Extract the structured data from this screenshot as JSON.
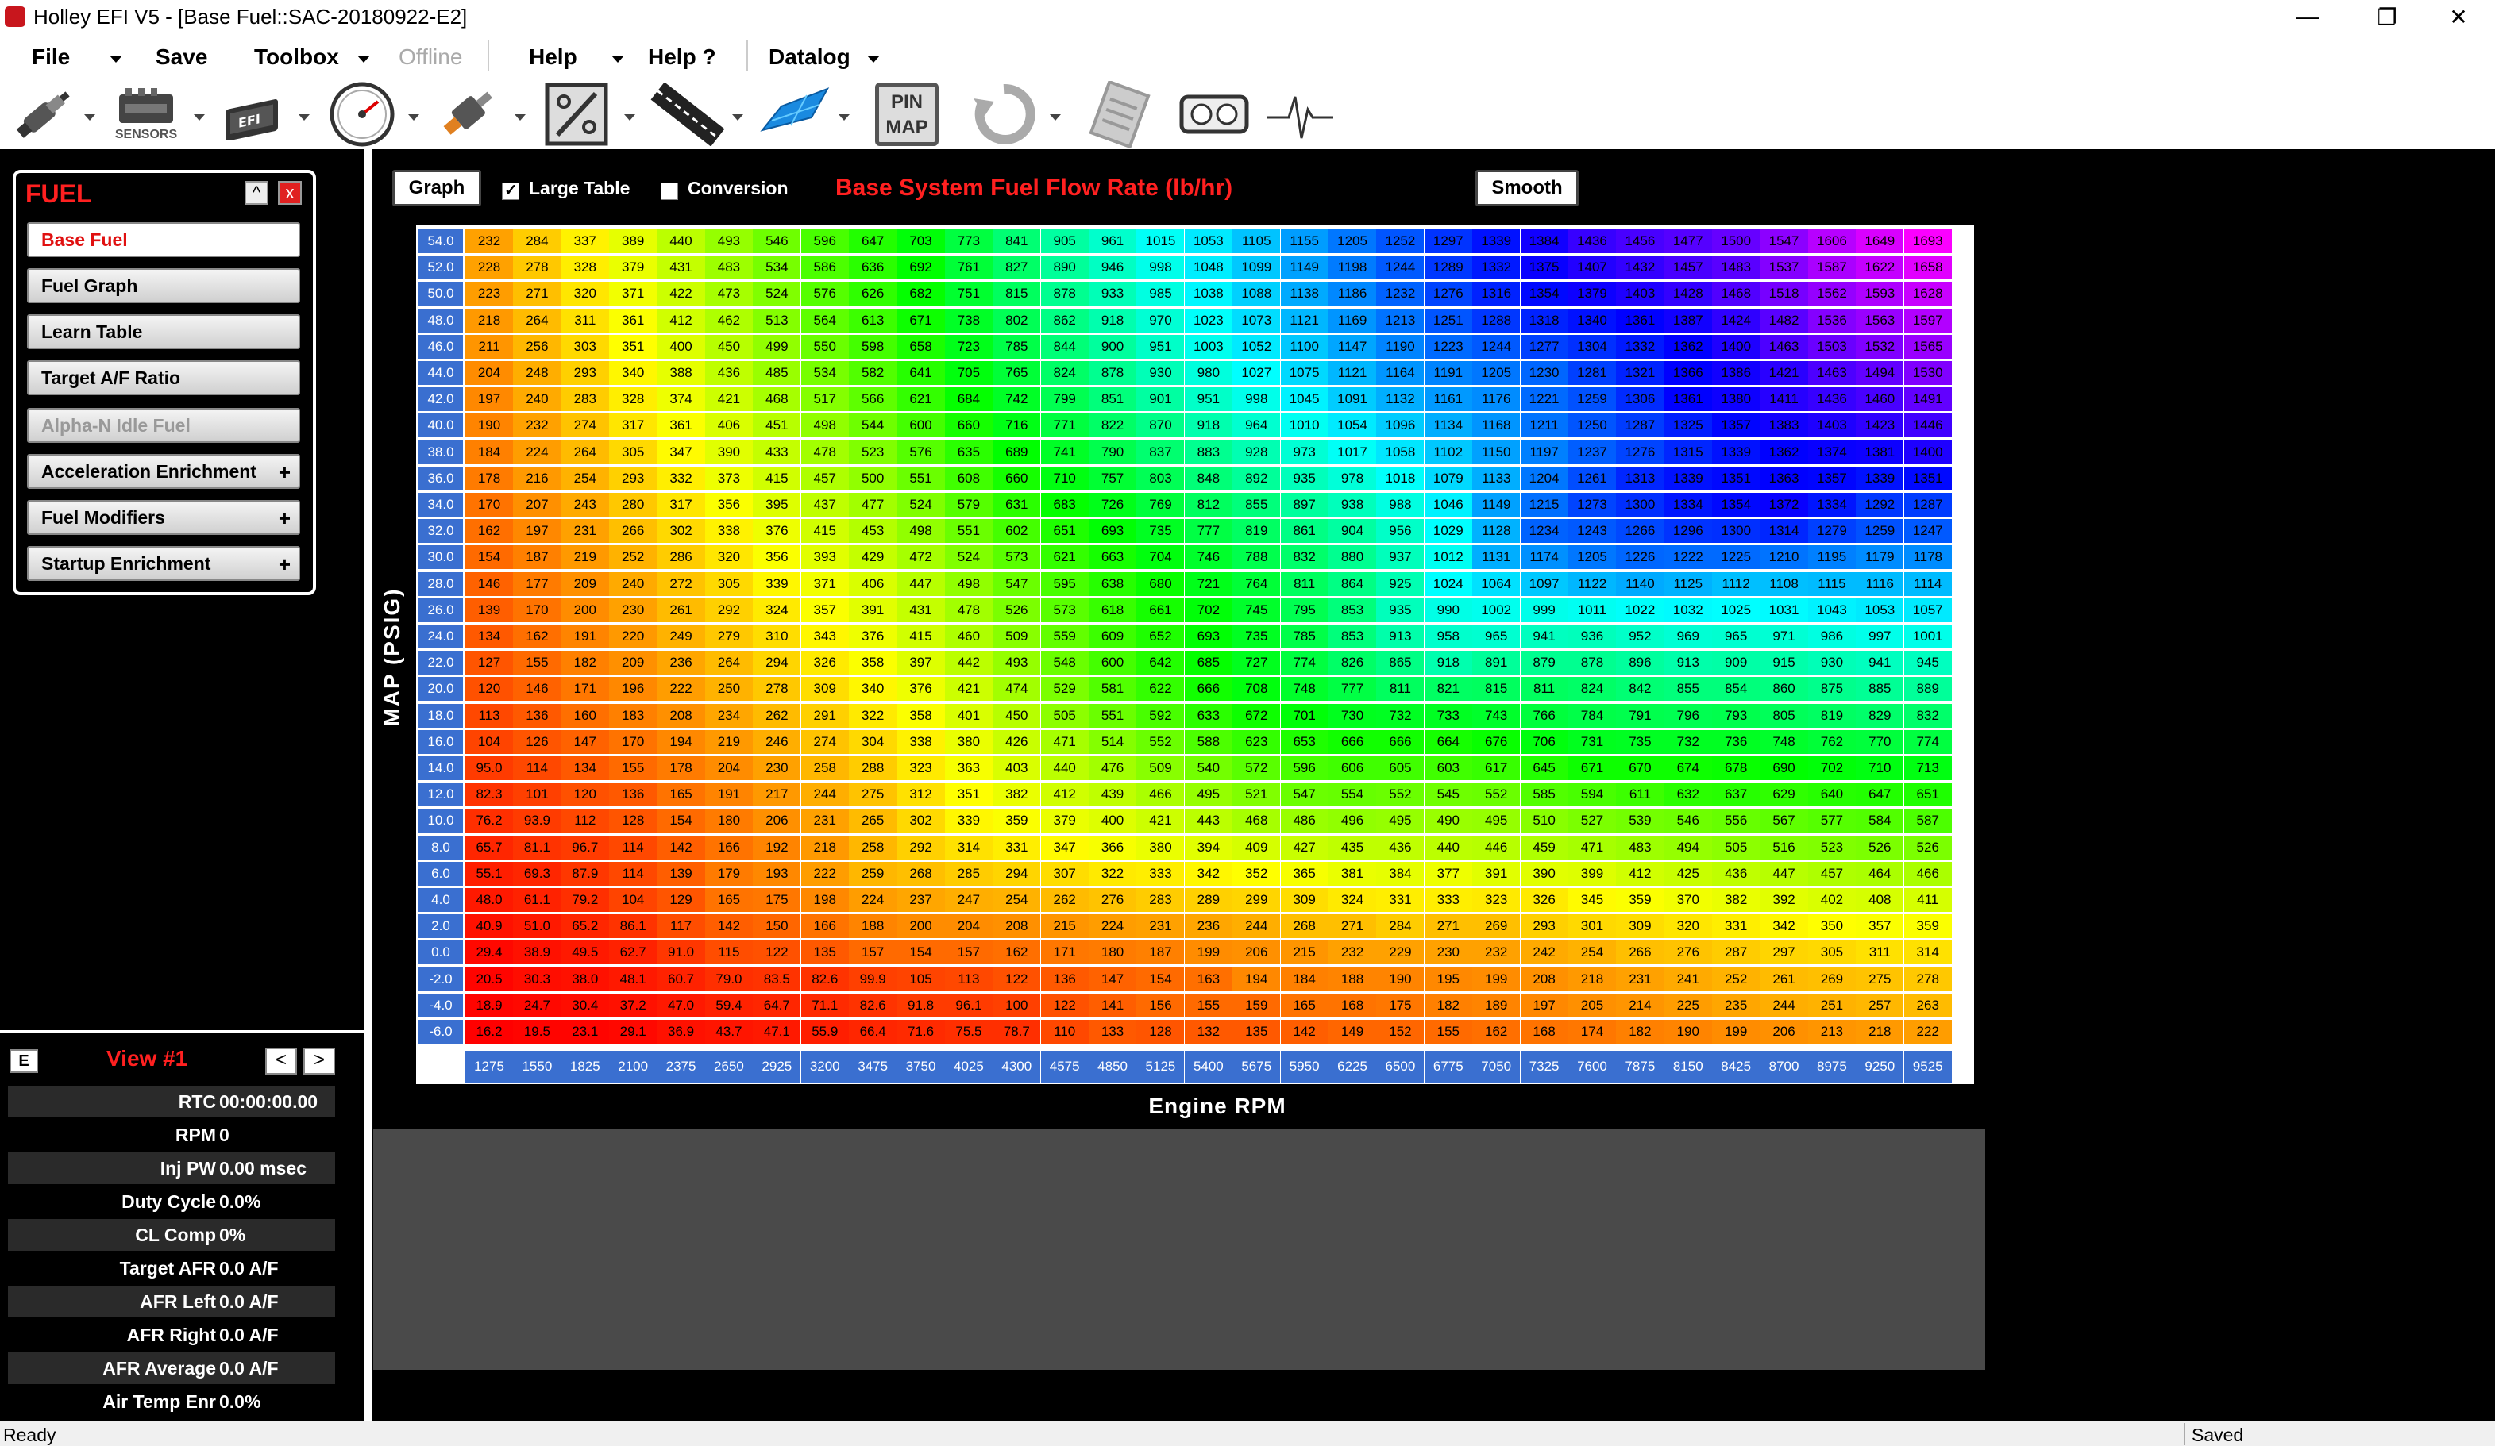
{
  "window": {
    "title": "Holley EFI V5 - [Base Fuel::SAC-20180922-E2]",
    "minimize": "—",
    "restore": "❐",
    "close": "✕"
  },
  "menu": [
    {
      "label": "File",
      "caret": true,
      "disabled": false
    },
    {
      "label": "Save",
      "caret": false,
      "disabled": false
    },
    {
      "label": "Toolbox",
      "caret": true,
      "disabled": false
    },
    {
      "label": "Offline",
      "caret": false,
      "disabled": true
    },
    {
      "label": "Help",
      "caret": true,
      "disabled": false
    },
    {
      "label": "Help ?",
      "caret": false,
      "disabled": false
    },
    {
      "label": "Datalog",
      "caret": true,
      "disabled": false
    }
  ],
  "toolbar": {
    "icons": [
      "injector-icon",
      "sensors-icon",
      "ecu-icon",
      "gauge-icon",
      "ignition-coil-icon",
      "percent-icon",
      "strap-icon",
      "grid-3d-icon",
      "pin-map-icon",
      "refresh-icon",
      "notepad-icon",
      "dashboard-icon",
      "waveform-icon"
    ],
    "sensors_label": "SENSORS",
    "pin_map_label": "PIN MAP"
  },
  "fuel_panel": {
    "title": "FUEL",
    "collapse": "^",
    "close": "x",
    "items": [
      {
        "label": "Base Fuel",
        "active": true,
        "disabled": false,
        "expandable": false
      },
      {
        "label": "Fuel Graph",
        "active": false,
        "disabled": false,
        "expandable": false
      },
      {
        "label": "Learn Table",
        "active": false,
        "disabled": false,
        "expandable": false
      },
      {
        "label": "Target A/F Ratio",
        "active": false,
        "disabled": false,
        "expandable": false
      },
      {
        "label": "Alpha-N Idle Fuel",
        "active": false,
        "disabled": true,
        "expandable": false
      },
      {
        "label": "Acceleration Enrichment",
        "active": false,
        "disabled": false,
        "expandable": true
      },
      {
        "label": "Fuel Modifiers",
        "active": false,
        "disabled": false,
        "expandable": true
      },
      {
        "label": "Startup Enrichment",
        "active": false,
        "disabled": false,
        "expandable": true
      }
    ]
  },
  "view_panel": {
    "e_button": "E",
    "title": "View #1",
    "prev": "<",
    "next": ">",
    "readouts": [
      {
        "label": "RTC",
        "value": "00:00:00.00"
      },
      {
        "label": "RPM",
        "value": "0"
      },
      {
        "label": "Inj PW",
        "value": "0.00 msec"
      },
      {
        "label": "Duty Cycle",
        "value": "0.0%"
      },
      {
        "label": "CL Comp",
        "value": "0%"
      },
      {
        "label": "Target AFR",
        "value": "0.0 A/F"
      },
      {
        "label": "AFR Left",
        "value": "0.0 A/F"
      },
      {
        "label": "AFR Right",
        "value": "0.0 A/F"
      },
      {
        "label": "AFR Average",
        "value": "0.0 A/F"
      },
      {
        "label": "Air Temp Enr",
        "value": "0.0%"
      }
    ]
  },
  "main": {
    "graph_button": "Graph",
    "large_table_label": "Large Table",
    "large_table_checked": true,
    "conversion_label": "Conversion",
    "conversion_checked": false,
    "table_title": "Base System Fuel Flow Rate (lb/hr)",
    "smooth_button": "Smooth",
    "y_axis_label": "MAP (PSIG)",
    "x_axis_label": "Engine RPM"
  },
  "table": {
    "rpm": [
      "1275",
      "1550",
      "1825",
      "2100",
      "2375",
      "2650",
      "2925",
      "3200",
      "3475",
      "3750",
      "4025",
      "4300",
      "4575",
      "4850",
      "5125",
      "5400",
      "5675",
      "5950",
      "6225",
      "6500",
      "6775",
      "7050",
      "7325",
      "7600",
      "7875",
      "8150",
      "8425",
      "8700",
      "8975",
      "9250",
      "9525"
    ],
    "map": [
      "54.0",
      "52.0",
      "50.0",
      "48.0",
      "46.0",
      "44.0",
      "42.0",
      "40.0",
      "38.0",
      "36.0",
      "34.0",
      "32.0",
      "30.0",
      "28.0",
      "26.0",
      "24.0",
      "22.0",
      "20.0",
      "18.0",
      "16.0",
      "14.0",
      "12.0",
      "10.0",
      "8.0",
      "6.0",
      "4.0",
      "2.0",
      "0.0",
      "-2.0",
      "-4.0",
      "-6.0"
    ],
    "values": [
      [
        "232",
        "284",
        "337",
        "389",
        "440",
        "493",
        "546",
        "596",
        "647",
        "703",
        "773",
        "841",
        "905",
        "961",
        "1015",
        "1053",
        "1105",
        "1155",
        "1205",
        "1252",
        "1297",
        "1339",
        "1384",
        "1436",
        "1456",
        "1477",
        "1500",
        "1547",
        "1606",
        "1649",
        "1693"
      ],
      [
        "228",
        "278",
        "328",
        "379",
        "431",
        "483",
        "534",
        "586",
        "636",
        "692",
        "761",
        "827",
        "890",
        "946",
        "998",
        "1048",
        "1099",
        "1149",
        "1198",
        "1244",
        "1289",
        "1332",
        "1375",
        "1407",
        "1432",
        "1457",
        "1483",
        "1537",
        "1587",
        "1622",
        "1658"
      ],
      [
        "223",
        "271",
        "320",
        "371",
        "422",
        "473",
        "524",
        "576",
        "626",
        "682",
        "751",
        "815",
        "878",
        "933",
        "985",
        "1038",
        "1088",
        "1138",
        "1186",
        "1232",
        "1276",
        "1316",
        "1354",
        "1379",
        "1403",
        "1428",
        "1468",
        "1518",
        "1562",
        "1593",
        "1628"
      ],
      [
        "218",
        "264",
        "311",
        "361",
        "412",
        "462",
        "513",
        "564",
        "613",
        "671",
        "738",
        "802",
        "862",
        "918",
        "970",
        "1023",
        "1073",
        "1121",
        "1169",
        "1213",
        "1251",
        "1288",
        "1318",
        "1340",
        "1361",
        "1387",
        "1424",
        "1482",
        "1536",
        "1563",
        "1597"
      ],
      [
        "211",
        "256",
        "303",
        "351",
        "400",
        "450",
        "499",
        "550",
        "598",
        "658",
        "723",
        "785",
        "844",
        "900",
        "951",
        "1003",
        "1052",
        "1100",
        "1147",
        "1190",
        "1223",
        "1244",
        "1277",
        "1304",
        "1332",
        "1362",
        "1400",
        "1463",
        "1503",
        "1532",
        "1565"
      ],
      [
        "204",
        "248",
        "293",
        "340",
        "388",
        "436",
        "485",
        "534",
        "582",
        "641",
        "705",
        "765",
        "824",
        "878",
        "930",
        "980",
        "1027",
        "1075",
        "1121",
        "1164",
        "1191",
        "1205",
        "1230",
        "1281",
        "1321",
        "1366",
        "1386",
        "1421",
        "1463",
        "1494",
        "1530"
      ],
      [
        "197",
        "240",
        "283",
        "328",
        "374",
        "421",
        "468",
        "517",
        "566",
        "621",
        "684",
        "742",
        "799",
        "851",
        "901",
        "951",
        "998",
        "1045",
        "1091",
        "1132",
        "1161",
        "1176",
        "1221",
        "1259",
        "1306",
        "1361",
        "1380",
        "1411",
        "1436",
        "1460",
        "1491"
      ],
      [
        "190",
        "232",
        "274",
        "317",
        "361",
        "406",
        "451",
        "498",
        "544",
        "600",
        "660",
        "716",
        "771",
        "822",
        "870",
        "918",
        "964",
        "1010",
        "1054",
        "1096",
        "1134",
        "1168",
        "1211",
        "1250",
        "1287",
        "1325",
        "1357",
        "1383",
        "1403",
        "1423",
        "1446"
      ],
      [
        "184",
        "224",
        "264",
        "305",
        "347",
        "390",
        "433",
        "478",
        "523",
        "576",
        "635",
        "689",
        "741",
        "790",
        "837",
        "883",
        "928",
        "973",
        "1017",
        "1058",
        "1102",
        "1150",
        "1197",
        "1237",
        "1276",
        "1315",
        "1339",
        "1362",
        "1374",
        "1381",
        "1400"
      ],
      [
        "178",
        "216",
        "254",
        "293",
        "332",
        "373",
        "415",
        "457",
        "500",
        "551",
        "608",
        "660",
        "710",
        "757",
        "803",
        "848",
        "892",
        "935",
        "978",
        "1018",
        "1079",
        "1133",
        "1204",
        "1261",
        "1313",
        "1339",
        "1351",
        "1363",
        "1357",
        "1339",
        "1351"
      ],
      [
        "170",
        "207",
        "243",
        "280",
        "317",
        "356",
        "395",
        "437",
        "477",
        "524",
        "579",
        "631",
        "683",
        "726",
        "769",
        "812",
        "855",
        "897",
        "938",
        "988",
        "1046",
        "1149",
        "1215",
        "1273",
        "1300",
        "1334",
        "1354",
        "1372",
        "1334",
        "1292",
        "1287"
      ],
      [
        "162",
        "197",
        "231",
        "266",
        "302",
        "338",
        "376",
        "415",
        "453",
        "498",
        "551",
        "602",
        "651",
        "693",
        "735",
        "777",
        "819",
        "861",
        "904",
        "956",
        "1029",
        "1128",
        "1234",
        "1243",
        "1266",
        "1296",
        "1300",
        "1314",
        "1279",
        "1259",
        "1247"
      ],
      [
        "154",
        "187",
        "219",
        "252",
        "286",
        "320",
        "356",
        "393",
        "429",
        "472",
        "524",
        "573",
        "621",
        "663",
        "704",
        "746",
        "788",
        "832",
        "880",
        "937",
        "1012",
        "1131",
        "1174",
        "1205",
        "1226",
        "1222",
        "1225",
        "1210",
        "1195",
        "1179",
        "1178"
      ],
      [
        "146",
        "177",
        "209",
        "240",
        "272",
        "305",
        "339",
        "371",
        "406",
        "447",
        "498",
        "547",
        "595",
        "638",
        "680",
        "721",
        "764",
        "811",
        "864",
        "925",
        "1024",
        "1064",
        "1097",
        "1122",
        "1140",
        "1125",
        "1112",
        "1108",
        "1115",
        "1116",
        "1114"
      ],
      [
        "139",
        "170",
        "200",
        "230",
        "261",
        "292",
        "324",
        "357",
        "391",
        "431",
        "478",
        "526",
        "573",
        "618",
        "661",
        "702",
        "745",
        "795",
        "853",
        "935",
        "990",
        "1002",
        "999",
        "1011",
        "1022",
        "1032",
        "1025",
        "1031",
        "1043",
        "1053",
        "1057"
      ],
      [
        "134",
        "162",
        "191",
        "220",
        "249",
        "279",
        "310",
        "343",
        "376",
        "415",
        "460",
        "509",
        "559",
        "609",
        "652",
        "693",
        "735",
        "785",
        "853",
        "913",
        "958",
        "965",
        "941",
        "936",
        "952",
        "969",
        "965",
        "971",
        "986",
        "997",
        "1001"
      ],
      [
        "127",
        "155",
        "182",
        "209",
        "236",
        "264",
        "294",
        "326",
        "358",
        "397",
        "442",
        "493",
        "548",
        "600",
        "642",
        "685",
        "727",
        "774",
        "826",
        "865",
        "918",
        "891",
        "879",
        "878",
        "896",
        "913",
        "909",
        "915",
        "930",
        "941",
        "945"
      ],
      [
        "120",
        "146",
        "171",
        "196",
        "222",
        "250",
        "278",
        "309",
        "340",
        "376",
        "421",
        "474",
        "529",
        "581",
        "622",
        "666",
        "708",
        "748",
        "777",
        "811",
        "821",
        "815",
        "811",
        "824",
        "842",
        "855",
        "854",
        "860",
        "875",
        "885",
        "889"
      ],
      [
        "113",
        "136",
        "160",
        "183",
        "208",
        "234",
        "262",
        "291",
        "322",
        "358",
        "401",
        "450",
        "505",
        "551",
        "592",
        "633",
        "672",
        "701",
        "730",
        "732",
        "733",
        "743",
        "766",
        "784",
        "791",
        "796",
        "793",
        "805",
        "819",
        "829",
        "832"
      ],
      [
        "104",
        "126",
        "147",
        "170",
        "194",
        "219",
        "246",
        "274",
        "304",
        "338",
        "380",
        "426",
        "471",
        "514",
        "552",
        "588",
        "623",
        "653",
        "666",
        "666",
        "664",
        "676",
        "706",
        "731",
        "735",
        "732",
        "736",
        "748",
        "762",
        "770",
        "774"
      ],
      [
        "95.0",
        "114",
        "134",
        "155",
        "178",
        "204",
        "230",
        "258",
        "288",
        "323",
        "363",
        "403",
        "440",
        "476",
        "509",
        "540",
        "572",
        "596",
        "606",
        "605",
        "603",
        "617",
        "645",
        "671",
        "670",
        "674",
        "678",
        "690",
        "702",
        "710",
        "713"
      ],
      [
        "82.3",
        "101",
        "120",
        "136",
        "165",
        "191",
        "217",
        "244",
        "275",
        "312",
        "351",
        "382",
        "412",
        "439",
        "466",
        "495",
        "521",
        "547",
        "554",
        "552",
        "545",
        "552",
        "585",
        "594",
        "611",
        "632",
        "637",
        "629",
        "640",
        "647",
        "651"
      ],
      [
        "76.2",
        "93.9",
        "112",
        "128",
        "154",
        "180",
        "206",
        "231",
        "265",
        "302",
        "339",
        "359",
        "379",
        "400",
        "421",
        "443",
        "468",
        "486",
        "496",
        "495",
        "490",
        "495",
        "510",
        "527",
        "539",
        "546",
        "556",
        "567",
        "577",
        "584",
        "587"
      ],
      [
        "65.7",
        "81.1",
        "96.7",
        "114",
        "142",
        "166",
        "192",
        "218",
        "258",
        "292",
        "314",
        "331",
        "347",
        "366",
        "380",
        "394",
        "409",
        "427",
        "435",
        "436",
        "440",
        "446",
        "459",
        "471",
        "483",
        "494",
        "505",
        "516",
        "523",
        "526",
        "526"
      ],
      [
        "55.1",
        "69.3",
        "87.9",
        "114",
        "139",
        "179",
        "193",
        "222",
        "259",
        "268",
        "285",
        "294",
        "307",
        "322",
        "333",
        "342",
        "352",
        "365",
        "381",
        "384",
        "377",
        "391",
        "390",
        "399",
        "412",
        "425",
        "436",
        "447",
        "457",
        "464",
        "466"
      ],
      [
        "48.0",
        "61.1",
        "79.2",
        "104",
        "129",
        "165",
        "175",
        "198",
        "224",
        "237",
        "247",
        "254",
        "262",
        "276",
        "283",
        "289",
        "299",
        "309",
        "324",
        "331",
        "333",
        "323",
        "326",
        "345",
        "359",
        "370",
        "382",
        "392",
        "402",
        "408",
        "411"
      ],
      [
        "40.9",
        "51.0",
        "65.2",
        "86.1",
        "117",
        "142",
        "150",
        "166",
        "188",
        "200",
        "204",
        "208",
        "215",
        "224",
        "231",
        "236",
        "244",
        "268",
        "271",
        "284",
        "271",
        "269",
        "293",
        "301",
        "309",
        "320",
        "331",
        "342",
        "350",
        "357",
        "359"
      ],
      [
        "29.4",
        "38.9",
        "49.5",
        "62.7",
        "91.0",
        "115",
        "122",
        "135",
        "157",
        "154",
        "157",
        "162",
        "171",
        "180",
        "187",
        "199",
        "206",
        "215",
        "232",
        "229",
        "230",
        "232",
        "242",
        "254",
        "266",
        "276",
        "287",
        "297",
        "305",
        "311",
        "314"
      ],
      [
        "20.5",
        "30.3",
        "38.0",
        "48.1",
        "60.7",
        "79.0",
        "83.5",
        "82.6",
        "99.9",
        "105",
        "113",
        "122",
        "136",
        "147",
        "154",
        "163",
        "194",
        "184",
        "188",
        "190",
        "195",
        "199",
        "208",
        "218",
        "231",
        "241",
        "252",
        "261",
        "269",
        "275",
        "278"
      ],
      [
        "18.9",
        "24.7",
        "30.4",
        "37.2",
        "47.0",
        "59.4",
        "64.7",
        "71.1",
        "82.6",
        "91.8",
        "96.1",
        "100",
        "122",
        "141",
        "156",
        "155",
        "159",
        "165",
        "168",
        "175",
        "182",
        "189",
        "197",
        "205",
        "214",
        "225",
        "235",
        "244",
        "251",
        "257",
        "263"
      ],
      [
        "16.2",
        "19.5",
        "23.1",
        "29.1",
        "36.9",
        "43.7",
        "47.1",
        "55.9",
        "66.4",
        "71.6",
        "75.5",
        "78.7",
        "110",
        "133",
        "128",
        "132",
        "135",
        "142",
        "149",
        "152",
        "155",
        "162",
        "168",
        "174",
        "182",
        "190",
        "199",
        "206",
        "213",
        "218",
        "222"
      ]
    ]
  },
  "status": {
    "left": "Ready",
    "right": "Saved"
  }
}
